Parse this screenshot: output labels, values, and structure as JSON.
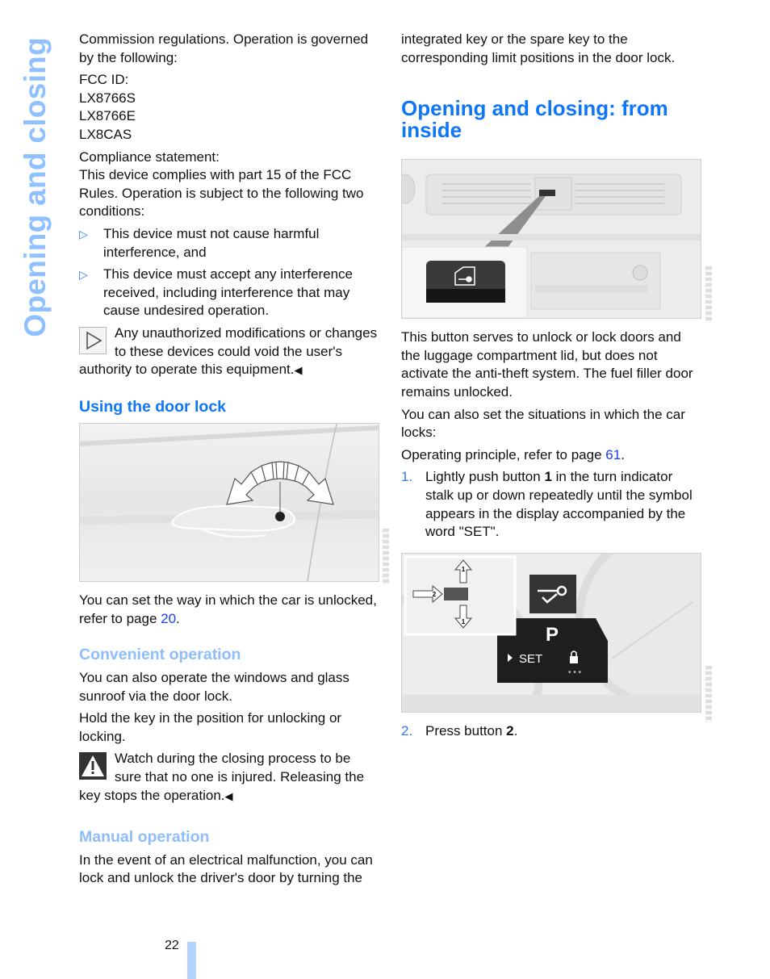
{
  "side_title": "Opening and closing",
  "left_column": {
    "intro": "Commission regulations. Operation is governed by the following:",
    "fcc_label": "FCC ID:",
    "fcc_ids": [
      "LX8766S",
      "LX8766E",
      "LX8CAS"
    ],
    "compliance_label": "Compliance statement:",
    "compliance_text": "This device complies with part 15 of the FCC Rules. Operation is subject to the following two conditions:",
    "bullets": [
      "This device must not cause harmful interference, and",
      "This device must accept any interference received, including interference that may cause undesired operation."
    ],
    "bullet_marker": "▷",
    "info_note": "Any unauthorized modifications or changes to these devices could void the user's authority to operate this equipment.",
    "end_marker": "◀",
    "door_lock_heading": "Using the door lock",
    "door_lock_text_pre": "You can set the way in which the car is unlocked, refer to page ",
    "door_lock_page_link": "20",
    "door_lock_text_post": ".",
    "convenient_heading": "Convenient operation",
    "convenient_p1": "You can also operate the windows and glass sunroof via the door lock.",
    "convenient_p2": "Hold the key in the position for unlocking or locking.",
    "warning_note": "Watch during the closing process to be sure that no one is injured. Releasing the key stops the operation.",
    "manual_heading": "Manual operation",
    "manual_text": "In the event of an electrical malfunction, you can lock and unlock the driver's door by turning the"
  },
  "right_column": {
    "continued_text": "integrated key or the spare key to the corresponding limit positions in the door lock.",
    "main_heading": "Opening and closing: from inside",
    "button_text": "This button serves to unlock or lock doors and the luggage compartment lid, but does not activate the anti-theft system. The fuel filler door remains unlocked.",
    "situations_text": "You can also set the situations in which the car locks:",
    "principle_pre": "Operating principle, refer to page ",
    "principle_page_link": "61",
    "principle_post": ".",
    "steps": [
      {
        "n": "1.",
        "pre": "Lightly push button ",
        "bold": "1",
        "post": " in the turn indicator stalk up or down repeatedly until the symbol appears in the display accompanied by the word \"SET\"."
      },
      {
        "n": "2.",
        "pre": "Press button ",
        "bold": "2",
        "post": "."
      }
    ],
    "display_figure": {
      "gear_label": "P",
      "set_label": "SET",
      "arrow_1_label": "1",
      "arrow_2_label": "2"
    }
  },
  "footer": {
    "page_number": "22"
  },
  "colors": {
    "heading_blue": "#0f76f5",
    "subheading_light_blue": "#8ebdfb",
    "side_title": "#8fc0ff",
    "link": "#1a3cff",
    "page_bar": "#b3d4ff"
  }
}
